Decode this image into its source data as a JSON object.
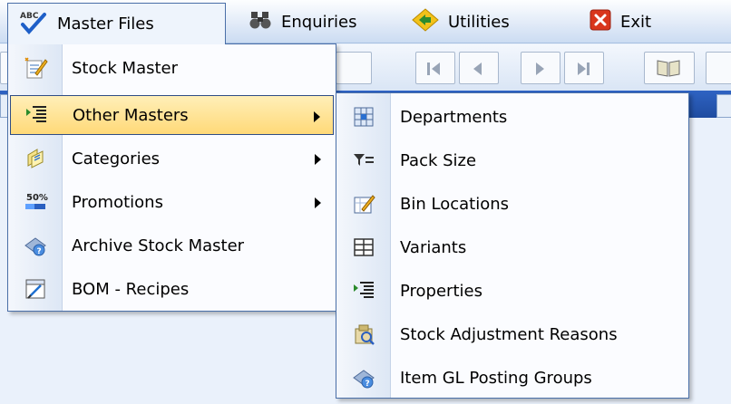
{
  "menubar": {
    "items": [
      {
        "label": "Master Files",
        "icon": "abc-check-icon"
      },
      {
        "label": "Enquiries",
        "icon": "binoculars-icon"
      },
      {
        "label": "Utilities",
        "icon": "diamond-arrows-icon"
      },
      {
        "label": "Exit",
        "icon": "close-icon"
      }
    ]
  },
  "master_files_menu": {
    "items": [
      {
        "label": "Stock Master",
        "icon": "pencil-page-icon"
      },
      {
        "label": "Other Masters",
        "icon": "list-indent-icon",
        "submenu": true,
        "highlighted": true
      },
      {
        "label": "Categories",
        "icon": "categories-icon",
        "submenu": true
      },
      {
        "label": "Promotions",
        "icon": "percent-tag-icon",
        "submenu": true
      },
      {
        "label": "Archive Stock Master",
        "icon": "archive-icon"
      },
      {
        "label": "BOM - Recipes",
        "icon": "recipe-icon"
      }
    ]
  },
  "other_masters_submenu": {
    "items": [
      {
        "label": "Departments",
        "icon": "departments-grid-icon"
      },
      {
        "label": "Pack Size",
        "icon": "filter-list-icon"
      },
      {
        "label": "Bin Locations",
        "icon": "bin-edit-icon"
      },
      {
        "label": "Variants",
        "icon": "table-icon"
      },
      {
        "label": "Properties",
        "icon": "properties-list-icon"
      },
      {
        "label": "Stock Adjustment Reasons",
        "icon": "adjustment-icon"
      },
      {
        "label": "Item GL Posting Groups",
        "icon": "gl-posting-icon"
      }
    ]
  },
  "colors": {
    "menu_border": "#4a6fa8",
    "highlight_top": "#ffefb8",
    "highlight_bottom": "#ffd978",
    "toolbar_strip": "#2f63c3"
  }
}
